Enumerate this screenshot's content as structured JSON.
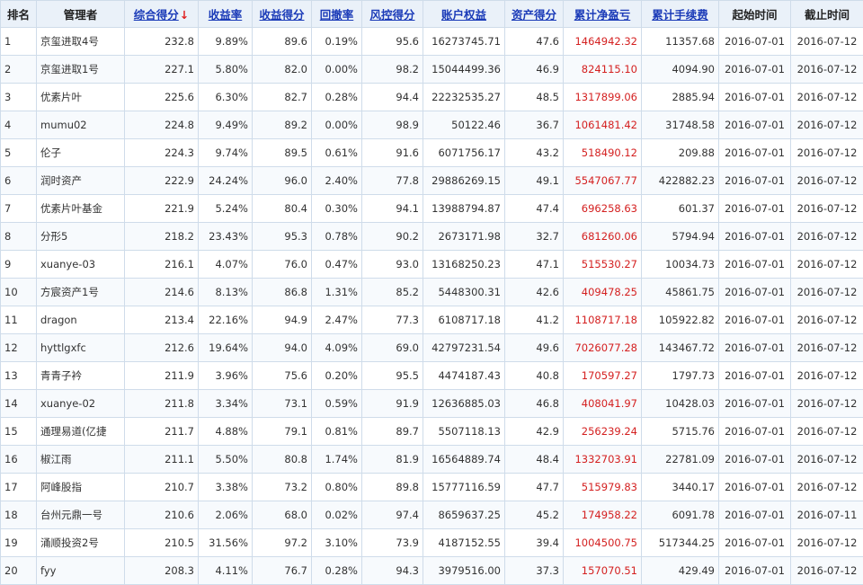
{
  "colors": {
    "header_bg": "#eaf1f9",
    "link": "#1b3bb8",
    "profit_red": "#d42020",
    "sort_arrow": "#e02020",
    "grid": "#cfdcea"
  },
  "columns": [
    {
      "key": "rank",
      "label": "排名",
      "sortable": false
    },
    {
      "key": "manager",
      "label": "管理者",
      "sortable": false
    },
    {
      "key": "overall",
      "label": "综合得分",
      "sortable": true,
      "sorted": "desc",
      "sort_icon": "arrow-down-icon",
      "sort_glyph": "↓"
    },
    {
      "key": "return_rate",
      "label": "收益率",
      "sortable": true
    },
    {
      "key": "return_score",
      "label": "收益得分",
      "sortable": true
    },
    {
      "key": "drawdown",
      "label": "回撤率",
      "sortable": true
    },
    {
      "key": "risk_score",
      "label": "风控得分",
      "sortable": true
    },
    {
      "key": "equity",
      "label": "账户权益",
      "sortable": true
    },
    {
      "key": "asset_score",
      "label": "资产得分",
      "sortable": true
    },
    {
      "key": "net_profit",
      "label": "累计净盈亏",
      "sortable": true
    },
    {
      "key": "fees",
      "label": "累计手续费",
      "sortable": true
    },
    {
      "key": "start",
      "label": "起始时间",
      "sortable": false
    },
    {
      "key": "end",
      "label": "截止时间",
      "sortable": false
    }
  ],
  "rows": [
    {
      "rank": "1",
      "manager": "京玺进取4号",
      "overall": "232.8",
      "return_rate": "9.89%",
      "return_score": "89.6",
      "drawdown": "0.19%",
      "risk_score": "95.6",
      "equity": "16273745.71",
      "asset_score": "47.6",
      "net_profit": "1464942.32",
      "fees": "11357.68",
      "start": "2016-07-01",
      "end": "2016-07-12"
    },
    {
      "rank": "2",
      "manager": "京玺进取1号",
      "overall": "227.1",
      "return_rate": "5.80%",
      "return_score": "82.0",
      "drawdown": "0.00%",
      "risk_score": "98.2",
      "equity": "15044499.36",
      "asset_score": "46.9",
      "net_profit": "824115.10",
      "fees": "4094.90",
      "start": "2016-07-01",
      "end": "2016-07-12"
    },
    {
      "rank": "3",
      "manager": "优素片叶",
      "overall": "225.6",
      "return_rate": "6.30%",
      "return_score": "82.7",
      "drawdown": "0.28%",
      "risk_score": "94.4",
      "equity": "22232535.27",
      "asset_score": "48.5",
      "net_profit": "1317899.06",
      "fees": "2885.94",
      "start": "2016-07-01",
      "end": "2016-07-12"
    },
    {
      "rank": "4",
      "manager": "mumu02",
      "overall": "224.8",
      "return_rate": "9.49%",
      "return_score": "89.2",
      "drawdown": "0.00%",
      "risk_score": "98.9",
      "equity": "50122.46",
      "asset_score": "36.7",
      "net_profit": "1061481.42",
      "fees": "31748.58",
      "start": "2016-07-01",
      "end": "2016-07-12"
    },
    {
      "rank": "5",
      "manager": "伦子",
      "overall": "224.3",
      "return_rate": "9.74%",
      "return_score": "89.5",
      "drawdown": "0.61%",
      "risk_score": "91.6",
      "equity": "6071756.17",
      "asset_score": "43.2",
      "net_profit": "518490.12",
      "fees": "209.88",
      "start": "2016-07-01",
      "end": "2016-07-12"
    },
    {
      "rank": "6",
      "manager": "润时资产",
      "overall": "222.9",
      "return_rate": "24.24%",
      "return_score": "96.0",
      "drawdown": "2.40%",
      "risk_score": "77.8",
      "equity": "29886269.15",
      "asset_score": "49.1",
      "net_profit": "5547067.77",
      "fees": "422882.23",
      "start": "2016-07-01",
      "end": "2016-07-12"
    },
    {
      "rank": "7",
      "manager": "优素片叶基金",
      "overall": "221.9",
      "return_rate": "5.24%",
      "return_score": "80.4",
      "drawdown": "0.30%",
      "risk_score": "94.1",
      "equity": "13988794.87",
      "asset_score": "47.4",
      "net_profit": "696258.63",
      "fees": "601.37",
      "start": "2016-07-01",
      "end": "2016-07-12"
    },
    {
      "rank": "8",
      "manager": "分形5",
      "overall": "218.2",
      "return_rate": "23.43%",
      "return_score": "95.3",
      "drawdown": "0.78%",
      "risk_score": "90.2",
      "equity": "2673171.98",
      "asset_score": "32.7",
      "net_profit": "681260.06",
      "fees": "5794.94",
      "start": "2016-07-01",
      "end": "2016-07-12"
    },
    {
      "rank": "9",
      "manager": "xuanye-03",
      "overall": "216.1",
      "return_rate": "4.07%",
      "return_score": "76.0",
      "drawdown": "0.47%",
      "risk_score": "93.0",
      "equity": "13168250.23",
      "asset_score": "47.1",
      "net_profit": "515530.27",
      "fees": "10034.73",
      "start": "2016-07-01",
      "end": "2016-07-12"
    },
    {
      "rank": "10",
      "manager": "方宸资产1号",
      "overall": "214.6",
      "return_rate": "8.13%",
      "return_score": "86.8",
      "drawdown": "1.31%",
      "risk_score": "85.2",
      "equity": "5448300.31",
      "asset_score": "42.6",
      "net_profit": "409478.25",
      "fees": "45861.75",
      "start": "2016-07-01",
      "end": "2016-07-12"
    },
    {
      "rank": "11",
      "manager": "dragon",
      "overall": "213.4",
      "return_rate": "22.16%",
      "return_score": "94.9",
      "drawdown": "2.47%",
      "risk_score": "77.3",
      "equity": "6108717.18",
      "asset_score": "41.2",
      "net_profit": "1108717.18",
      "fees": "105922.82",
      "start": "2016-07-01",
      "end": "2016-07-12"
    },
    {
      "rank": "12",
      "manager": "hyttlgxfc",
      "overall": "212.6",
      "return_rate": "19.64%",
      "return_score": "94.0",
      "drawdown": "4.09%",
      "risk_score": "69.0",
      "equity": "42797231.54",
      "asset_score": "49.6",
      "net_profit": "7026077.28",
      "fees": "143467.72",
      "start": "2016-07-01",
      "end": "2016-07-12"
    },
    {
      "rank": "13",
      "manager": "青青子衿",
      "overall": "211.9",
      "return_rate": "3.96%",
      "return_score": "75.6",
      "drawdown": "0.20%",
      "risk_score": "95.5",
      "equity": "4474187.43",
      "asset_score": "40.8",
      "net_profit": "170597.27",
      "fees": "1797.73",
      "start": "2016-07-01",
      "end": "2016-07-12"
    },
    {
      "rank": "14",
      "manager": "xuanye-02",
      "overall": "211.8",
      "return_rate": "3.34%",
      "return_score": "73.1",
      "drawdown": "0.59%",
      "risk_score": "91.9",
      "equity": "12636885.03",
      "asset_score": "46.8",
      "net_profit": "408041.97",
      "fees": "10428.03",
      "start": "2016-07-01",
      "end": "2016-07-12"
    },
    {
      "rank": "15",
      "manager": "通理易道(亿捷",
      "overall": "211.7",
      "return_rate": "4.88%",
      "return_score": "79.1",
      "drawdown": "0.81%",
      "risk_score": "89.7",
      "equity": "5507118.13",
      "asset_score": "42.9",
      "net_profit": "256239.24",
      "fees": "5715.76",
      "start": "2016-07-01",
      "end": "2016-07-12"
    },
    {
      "rank": "16",
      "manager": "椒江雨",
      "overall": "211.1",
      "return_rate": "5.50%",
      "return_score": "80.8",
      "drawdown": "1.74%",
      "risk_score": "81.9",
      "equity": "16564889.74",
      "asset_score": "48.4",
      "net_profit": "1332703.91",
      "fees": "22781.09",
      "start": "2016-07-01",
      "end": "2016-07-12"
    },
    {
      "rank": "17",
      "manager": "阿峰股指",
      "overall": "210.7",
      "return_rate": "3.38%",
      "return_score": "73.2",
      "drawdown": "0.80%",
      "risk_score": "89.8",
      "equity": "15777116.59",
      "asset_score": "47.7",
      "net_profit": "515979.83",
      "fees": "3440.17",
      "start": "2016-07-01",
      "end": "2016-07-12"
    },
    {
      "rank": "18",
      "manager": "台州元鼎一号",
      "overall": "210.6",
      "return_rate": "2.06%",
      "return_score": "68.0",
      "drawdown": "0.02%",
      "risk_score": "97.4",
      "equity": "8659637.25",
      "asset_score": "45.2",
      "net_profit": "174958.22",
      "fees": "6091.78",
      "start": "2016-07-01",
      "end": "2016-07-11"
    },
    {
      "rank": "19",
      "manager": "涌顺投资2号",
      "overall": "210.5",
      "return_rate": "31.56%",
      "return_score": "97.2",
      "drawdown": "3.10%",
      "risk_score": "73.9",
      "equity": "4187152.55",
      "asset_score": "39.4",
      "net_profit": "1004500.75",
      "fees": "517344.25",
      "start": "2016-07-01",
      "end": "2016-07-12"
    },
    {
      "rank": "20",
      "manager": "fyy",
      "overall": "208.3",
      "return_rate": "4.11%",
      "return_score": "76.7",
      "drawdown": "0.28%",
      "risk_score": "94.3",
      "equity": "3979516.00",
      "asset_score": "37.3",
      "net_profit": "157070.51",
      "fees": "429.49",
      "start": "2016-07-01",
      "end": "2016-07-12"
    }
  ]
}
